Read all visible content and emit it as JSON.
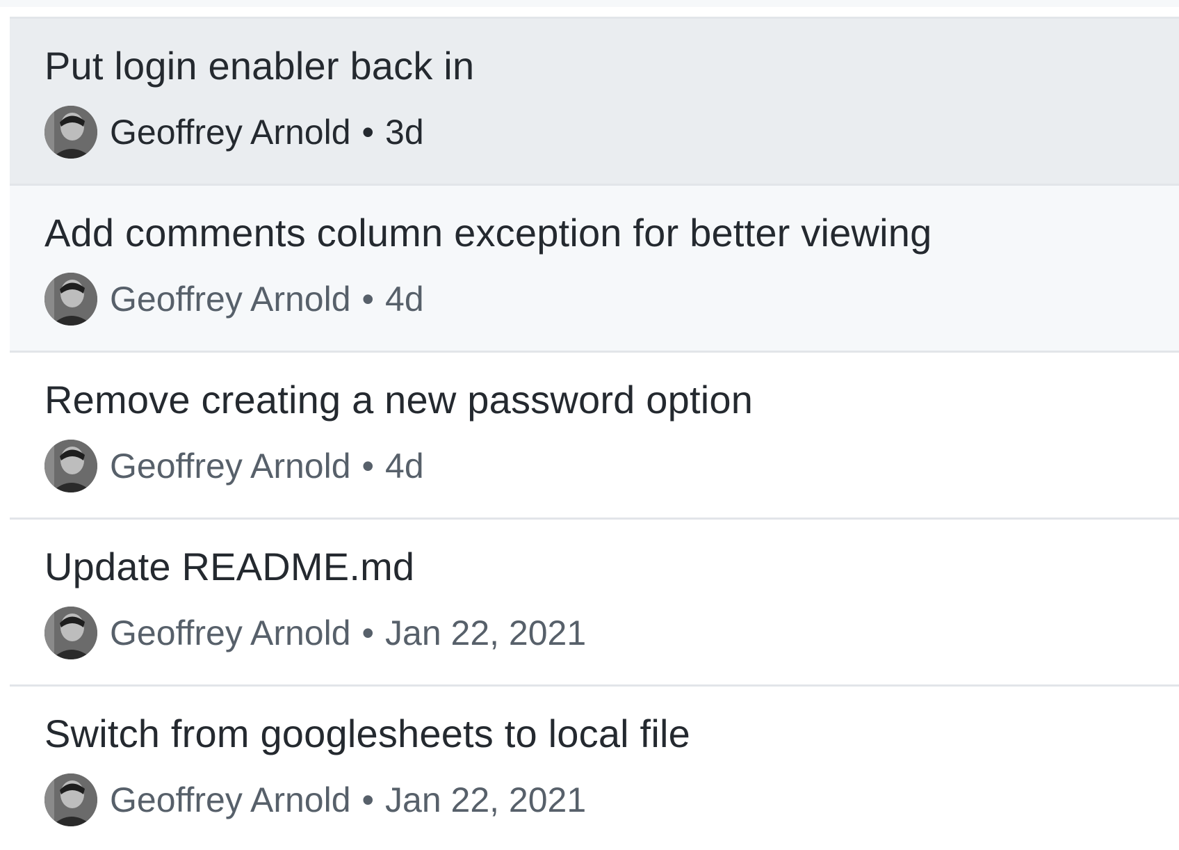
{
  "commits": [
    {
      "title": "Put login enabler back in",
      "author": "Geoffrey Arnold",
      "separator": "•",
      "time": "3d"
    },
    {
      "title": "Add comments column exception for better viewing",
      "author": "Geoffrey Arnold",
      "separator": "•",
      "time": "4d"
    },
    {
      "title": "Remove creating a new password option",
      "author": "Geoffrey Arnold",
      "separator": "•",
      "time": "4d"
    },
    {
      "title": "Update README.md",
      "author": "Geoffrey Arnold",
      "separator": "•",
      "time": "Jan 22, 2021"
    },
    {
      "title": "Switch from googlesheets to local file",
      "author": "Geoffrey Arnold",
      "separator": "•",
      "time": "Jan 22, 2021"
    }
  ],
  "avatar_icon": "user-avatar-photo",
  "colors": {
    "active_row": "#eaedf0",
    "hover_row": "#f6f8fa",
    "title_text": "#24292f",
    "meta_text": "#57606a",
    "divider": "#e2e5e9"
  }
}
